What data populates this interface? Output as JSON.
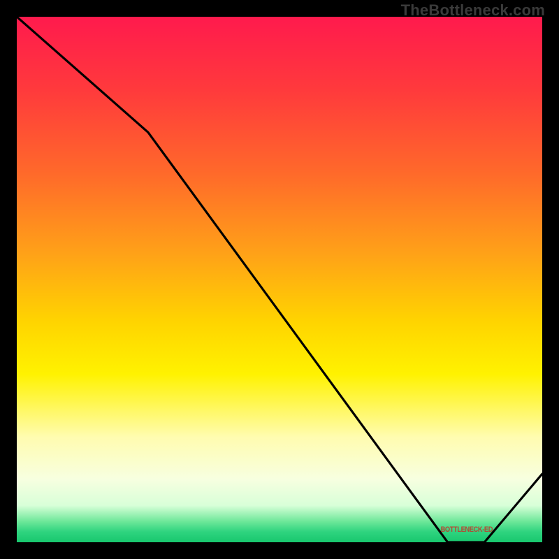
{
  "watermark": "TheBottleneck.com",
  "bottom_label": "BOTTLENECK-ED",
  "colors": {
    "top": "#ff1a4d",
    "mid_high": "#ffa118",
    "mid": "#fff200",
    "low": "#18c76e",
    "line": "#000000",
    "frame": "#000000",
    "label": "#c0392b",
    "watermark": "#3a3a3a"
  },
  "chart_data": {
    "type": "line",
    "title": "",
    "xlabel": "",
    "ylabel": "",
    "xlim": [
      0,
      100
    ],
    "ylim": [
      0,
      100
    ],
    "grid": false,
    "series": [
      {
        "name": "bottleneck-curve",
        "x": [
          0,
          25,
          82,
          89,
          100
        ],
        "y": [
          100,
          78,
          0,
          0,
          13
        ]
      }
    ],
    "annotations": [
      {
        "text": "BOTTLENECK-ED",
        "x": 85,
        "y": 1
      }
    ]
  }
}
